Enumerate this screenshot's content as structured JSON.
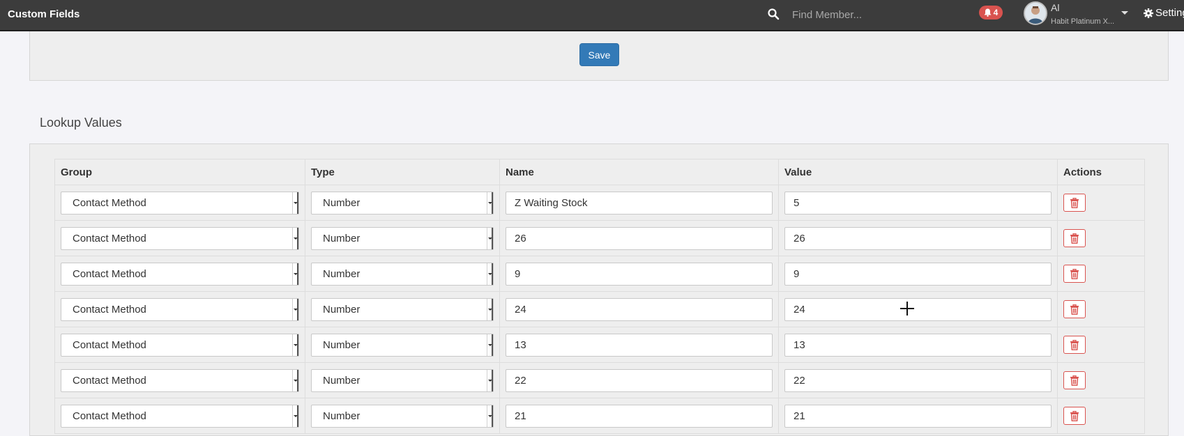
{
  "header": {
    "title": "Custom Fields",
    "search": {
      "placeholder": "Find Member...",
      "value": ""
    },
    "notifications": {
      "count": "4",
      "icon": "bell-icon"
    },
    "user": {
      "name": "Al",
      "organization": "Habit Platinum X..."
    },
    "settings_label": "Settings"
  },
  "save_panel": {
    "save_label": "Save"
  },
  "lookup": {
    "title": "Lookup Values",
    "columns": {
      "group": "Group",
      "type": "Type",
      "name": "Name",
      "value": "Value",
      "actions": "Actions"
    },
    "rows": [
      {
        "group": "Contact Method",
        "type": "Number",
        "name": "Z Waiting Stock",
        "value": "5"
      },
      {
        "group": "Contact Method",
        "type": "Number",
        "name": "26",
        "value": "26"
      },
      {
        "group": "Contact Method",
        "type": "Number",
        "name": "9",
        "value": "9"
      },
      {
        "group": "Contact Method",
        "type": "Number",
        "name": "24",
        "value": "24"
      },
      {
        "group": "Contact Method",
        "type": "Number",
        "name": "13",
        "value": "13"
      },
      {
        "group": "Contact Method",
        "type": "Number",
        "name": "22",
        "value": "22"
      },
      {
        "group": "Contact Method",
        "type": "Number",
        "name": "21",
        "value": "21"
      }
    ]
  },
  "colors": {
    "topbar": "#3c3c3c",
    "primary": "#337ab7",
    "danger": "#d9534f",
    "panel": "#eeeeee",
    "background": "#f4f4f8"
  }
}
